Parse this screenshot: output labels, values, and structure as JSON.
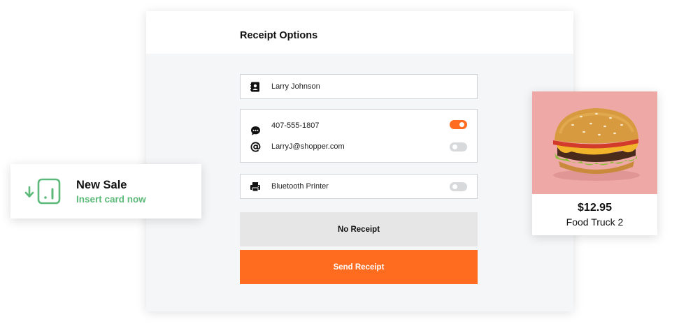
{
  "receipt": {
    "title": "Receipt Options",
    "customer_name": "Larry Johnson",
    "phone": "407-555-1807",
    "phone_enabled": true,
    "email": "LarryJ@shopper.com",
    "email_enabled": false,
    "printer": "Bluetooth Printer",
    "printer_enabled": false,
    "no_receipt_label": "No Receipt",
    "send_receipt_label": "Send Receipt"
  },
  "sale": {
    "title": "New Sale",
    "subtitle": "Insert card now"
  },
  "product": {
    "price": "$12.95",
    "name": "Food Truck 2"
  },
  "colors": {
    "accent": "#ff6b1f",
    "success": "#5cb979",
    "toggle_off": "#d8d9db",
    "panel_bg": "#f5f6f8"
  },
  "icons": [
    "contact-book-icon",
    "chat-bubble-icon",
    "at-sign-icon",
    "printer-icon",
    "card-reader-icon",
    "arrow-down-icon"
  ]
}
